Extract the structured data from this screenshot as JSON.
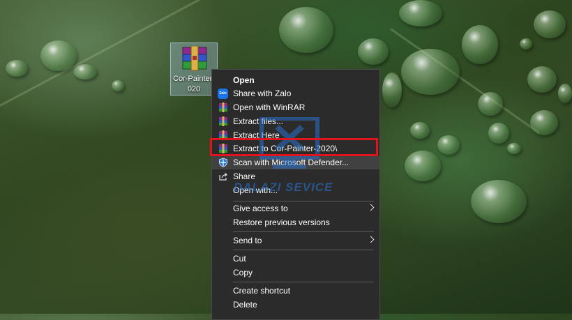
{
  "desktop_icon": {
    "label": "Cor-Painter-\n020"
  },
  "menu": {
    "items": [
      {
        "label": "Open"
      },
      {
        "label": "Share with Zalo",
        "icon_text": "Zalo"
      },
      {
        "label": "Open with WinRAR"
      },
      {
        "label": "Extract files..."
      },
      {
        "label": "Extract Here"
      },
      {
        "label": "Extract to Cor-Painter-2020\\"
      },
      {
        "label": "Scan with Microsoft Defender..."
      },
      {
        "label": "Share"
      },
      {
        "label": "Open with..."
      },
      {
        "label": "Give access to"
      },
      {
        "label": "Restore previous versions"
      },
      {
        "label": "Send to"
      },
      {
        "label": "Cut"
      },
      {
        "label": "Copy"
      },
      {
        "label": "Create shortcut"
      },
      {
        "label": "Delete"
      }
    ]
  },
  "watermark": {
    "text": "DALAZI SEVICE"
  },
  "colors": {
    "menu_bg": "#2b2b2b",
    "highlight_box": "#e0141c",
    "watermark": "#2b78d8"
  }
}
